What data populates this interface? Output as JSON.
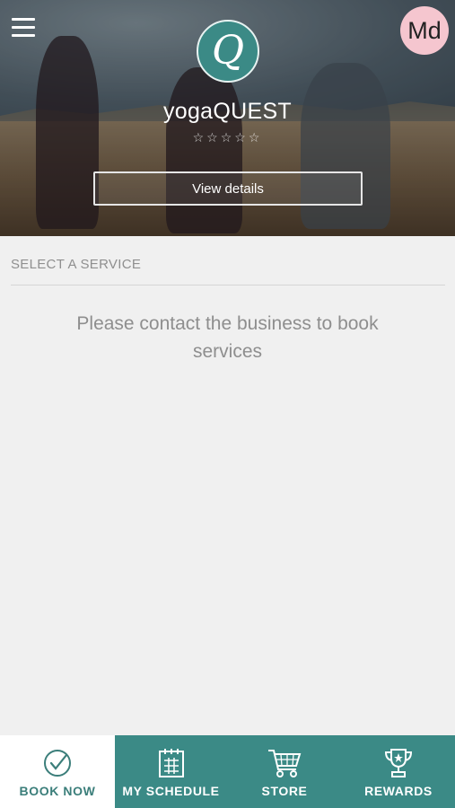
{
  "header": {
    "business_name": "yogaQUEST",
    "logo_letter": "Q",
    "rating_stars": "☆☆☆☆☆",
    "view_details_label": "View details",
    "avatar_initials": "Md"
  },
  "main": {
    "section_title": "SELECT A SERVICE",
    "empty_message": "Please contact the business to book services"
  },
  "tabs": [
    {
      "label": "BOOK NOW",
      "icon": "check-circle-icon",
      "active": true
    },
    {
      "label": "MY SCHEDULE",
      "icon": "calendar-icon",
      "active": false
    },
    {
      "label": "STORE",
      "icon": "cart-icon",
      "active": false
    },
    {
      "label": "REWARDS",
      "icon": "trophy-icon",
      "active": false
    }
  ],
  "colors": {
    "brand": "#3b8a86",
    "active_tab_bg": "#ffffff",
    "avatar_bg": "#f5c6cf"
  }
}
